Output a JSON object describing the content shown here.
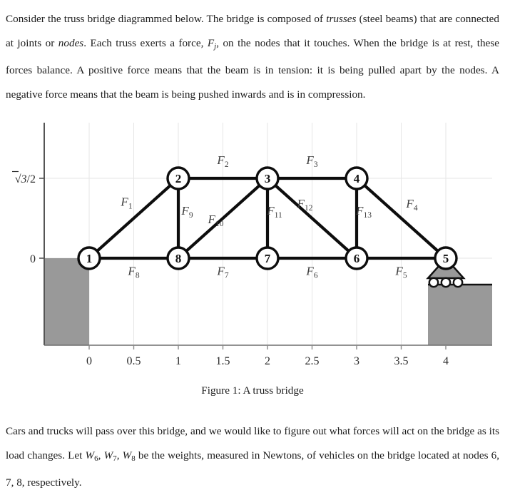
{
  "document": {
    "intro_paragraph_runs": [
      {
        "t": "Consider the truss bridge diagrammed below. The bridge is composed of ",
        "s": "normal"
      },
      {
        "t": "trusses",
        "s": "italic"
      },
      {
        "t": " (steel beams) that are connected at joints or ",
        "s": "normal"
      },
      {
        "t": "nodes",
        "s": "italic"
      },
      {
        "t": ". Each truss exerts a force, ",
        "s": "normal"
      },
      {
        "t": "F",
        "s": "math"
      },
      {
        "t": "j",
        "s": "mathsub"
      },
      {
        "t": ", on the nodes that it touches. When the bridge is at rest, these forces balance. A positive force means that the beam is in tension: it is being pulled apart by the nodes. A negative force means that the beam is being pushed inwards and is in compression.",
        "s": "normal"
      }
    ],
    "closing_paragraph_runs": [
      {
        "t": "Cars and trucks will pass over this bridge, and we would like to figure out what forces will act on the bridge as its load changes. Let ",
        "s": "normal"
      },
      {
        "t": "W",
        "s": "math"
      },
      {
        "t": "6",
        "s": "mathsub"
      },
      {
        "t": ", ",
        "s": "normal"
      },
      {
        "t": "W",
        "s": "math"
      },
      {
        "t": "7",
        "s": "mathsub"
      },
      {
        "t": ", ",
        "s": "normal"
      },
      {
        "t": "W",
        "s": "math"
      },
      {
        "t": "8",
        "s": "mathsub"
      },
      {
        "t": " be the weights, measured in Newtons, of vehicles on the bridge located at nodes 6, 7, 8, respectively.",
        "s": "normal"
      }
    ],
    "figure_caption": "Figure 1: A truss bridge"
  },
  "chart_data": {
    "type": "diagram",
    "title": "A truss bridge",
    "xlabel": "",
    "ylabel": "",
    "xlim": [
      -0.5,
      4.5
    ],
    "ylim": [
      -0.9,
      1.35
    ],
    "grid": true,
    "legend": "none",
    "x_tick_labels": [
      "0",
      "0.5",
      "1",
      "1.5",
      "2",
      "2.5",
      "3",
      "3.5",
      "4"
    ],
    "x_tick_values": [
      0,
      0.5,
      1,
      1.5,
      2,
      2.5,
      3,
      3.5,
      4
    ],
    "y_tick_labels": [
      "0",
      "√3/2"
    ],
    "y_tick_values": [
      0,
      0.866
    ],
    "nodes": [
      {
        "id": "1",
        "x": 0.0,
        "y": 0.0
      },
      {
        "id": "2",
        "x": 1.0,
        "y": 0.866
      },
      {
        "id": "3",
        "x": 2.0,
        "y": 0.866
      },
      {
        "id": "4",
        "x": 3.0,
        "y": 0.866
      },
      {
        "id": "5",
        "x": 4.0,
        "y": 0.0
      },
      {
        "id": "6",
        "x": 3.0,
        "y": 0.0
      },
      {
        "id": "7",
        "x": 2.0,
        "y": 0.0
      },
      {
        "id": "8",
        "x": 1.0,
        "y": 0.0
      }
    ],
    "members": [
      {
        "label": "F",
        "sub": "1",
        "from": "1",
        "to": "2",
        "lx": 0.42,
        "ly": 0.57
      },
      {
        "label": "F",
        "sub": "2",
        "from": "2",
        "to": "3",
        "lx": 1.5,
        "ly": 1.02
      },
      {
        "label": "F",
        "sub": "3",
        "from": "3",
        "to": "4",
        "lx": 2.5,
        "ly": 1.02
      },
      {
        "label": "F",
        "sub": "4",
        "from": "4",
        "to": "5",
        "lx": 3.62,
        "ly": 0.55
      },
      {
        "label": "F",
        "sub": "5",
        "from": "6",
        "to": "5",
        "lx": 3.5,
        "ly": -0.18
      },
      {
        "label": "F",
        "sub": "6",
        "from": "7",
        "to": "6",
        "lx": 2.5,
        "ly": -0.18
      },
      {
        "label": "F",
        "sub": "7",
        "from": "8",
        "to": "7",
        "lx": 1.5,
        "ly": -0.18
      },
      {
        "label": "F",
        "sub": "8",
        "from": "1",
        "to": "8",
        "lx": 0.5,
        "ly": -0.18
      },
      {
        "label": "F",
        "sub": "9",
        "from": "2",
        "to": "8",
        "lx": 1.1,
        "ly": 0.47
      },
      {
        "label": "F",
        "sub": "10",
        "from": "8",
        "to": "3",
        "lx": 1.42,
        "ly": 0.38
      },
      {
        "label": "F",
        "sub": "11",
        "from": "3",
        "to": "7",
        "lx": 2.08,
        "ly": 0.47
      },
      {
        "label": "F",
        "sub": "12",
        "from": "3",
        "to": "6",
        "lx": 2.42,
        "ly": 0.55
      },
      {
        "label": "F",
        "sub": "13",
        "from": "4",
        "to": "6",
        "lx": 3.08,
        "ly": 0.47
      }
    ],
    "supports": [
      {
        "kind": "fixed-abutment-left",
        "x_from": -0.5,
        "x_to": 0.0,
        "y_top": 0.0
      },
      {
        "kind": "roller-support",
        "at_node": "5",
        "wheels": 3
      },
      {
        "kind": "fixed-abutment-right",
        "x_from": 3.6,
        "x_to": 4.5,
        "y_top": -0.3
      }
    ],
    "colors": {
      "beam": "#0d0d0d",
      "node_fill": "#ffffff",
      "node_stroke": "#0d0d0d",
      "abutment_gray": "#999999",
      "grid": "#e3e3e3",
      "axis": "#555555"
    }
  }
}
